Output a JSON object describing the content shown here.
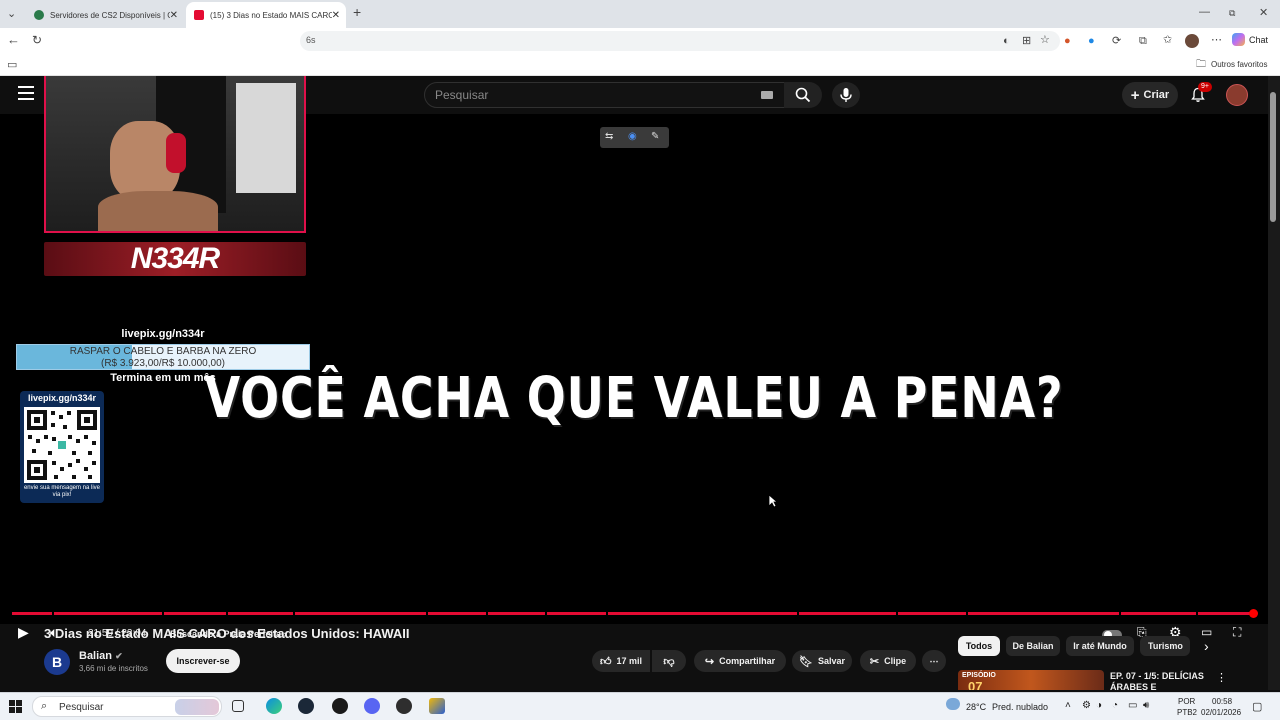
{
  "browser": {
    "tabs": [
      {
        "title": "Servidores de CS2 Disponíveis | Ga",
        "active": false
      },
      {
        "title": "(15) 3 Dias no Estado MAIS CARO",
        "active": true
      }
    ],
    "address_fragment": "6s",
    "chat_label": "Chat",
    "bookmarks_label": "Outros favoritos"
  },
  "youtube": {
    "search_placeholder": "Pesquisar",
    "create_label": "Criar",
    "notification_badge": "9+",
    "overlay": {
      "headline": "VOCÊ ACHA QUE VALEU A PENA?",
      "streamer_name": "N334R",
      "goal_url": "livepix.gg/n334r",
      "goal_title": "RASPAR O CABELO E BARBA NA ZERO",
      "goal_amount": "(R$ 3.923,00/R$ 10.000,00)",
      "goal_progress": 0.3923,
      "goal_time": "Termina em um mês",
      "qr_title": "livepix.gg/n334r",
      "qr_note": "envie sua mensagem na live via pix!"
    },
    "player": {
      "current_time": "21:59",
      "duration": "22:04",
      "time_display": "21:59 / 22:04",
      "chapter": "Buscando a Praia Perfeita",
      "progress": 0.996
    },
    "video": {
      "title": "3 Dias no Estado MAIS CARO dos Estados Unidos: HAWAII",
      "channel": "Balian",
      "channel_initial": "B",
      "subscribers": "3,66 mi de inscritos",
      "subscribe_label": "Inscrever-se",
      "likes": "17 mil",
      "share_label": "Compartilhar",
      "save_label": "Salvar",
      "clip_label": "Clipe"
    },
    "chips": [
      "Todos",
      "De Balian",
      "Ir até Mundo",
      "Turismo"
    ],
    "recommendation": {
      "title": "EP. 07 - 1/5: DELÍCIAS ÁRABES E",
      "thumb_label": "EPISÓDIO",
      "thumb_number": "07"
    }
  },
  "taskbar": {
    "search_placeholder": "Pesquisar",
    "weather": "28°C",
    "weather_desc": "Pred. nublado",
    "lang_top": "POR",
    "lang_bottom": "PTB2",
    "time": "00:58",
    "date": "02/01/2026"
  }
}
